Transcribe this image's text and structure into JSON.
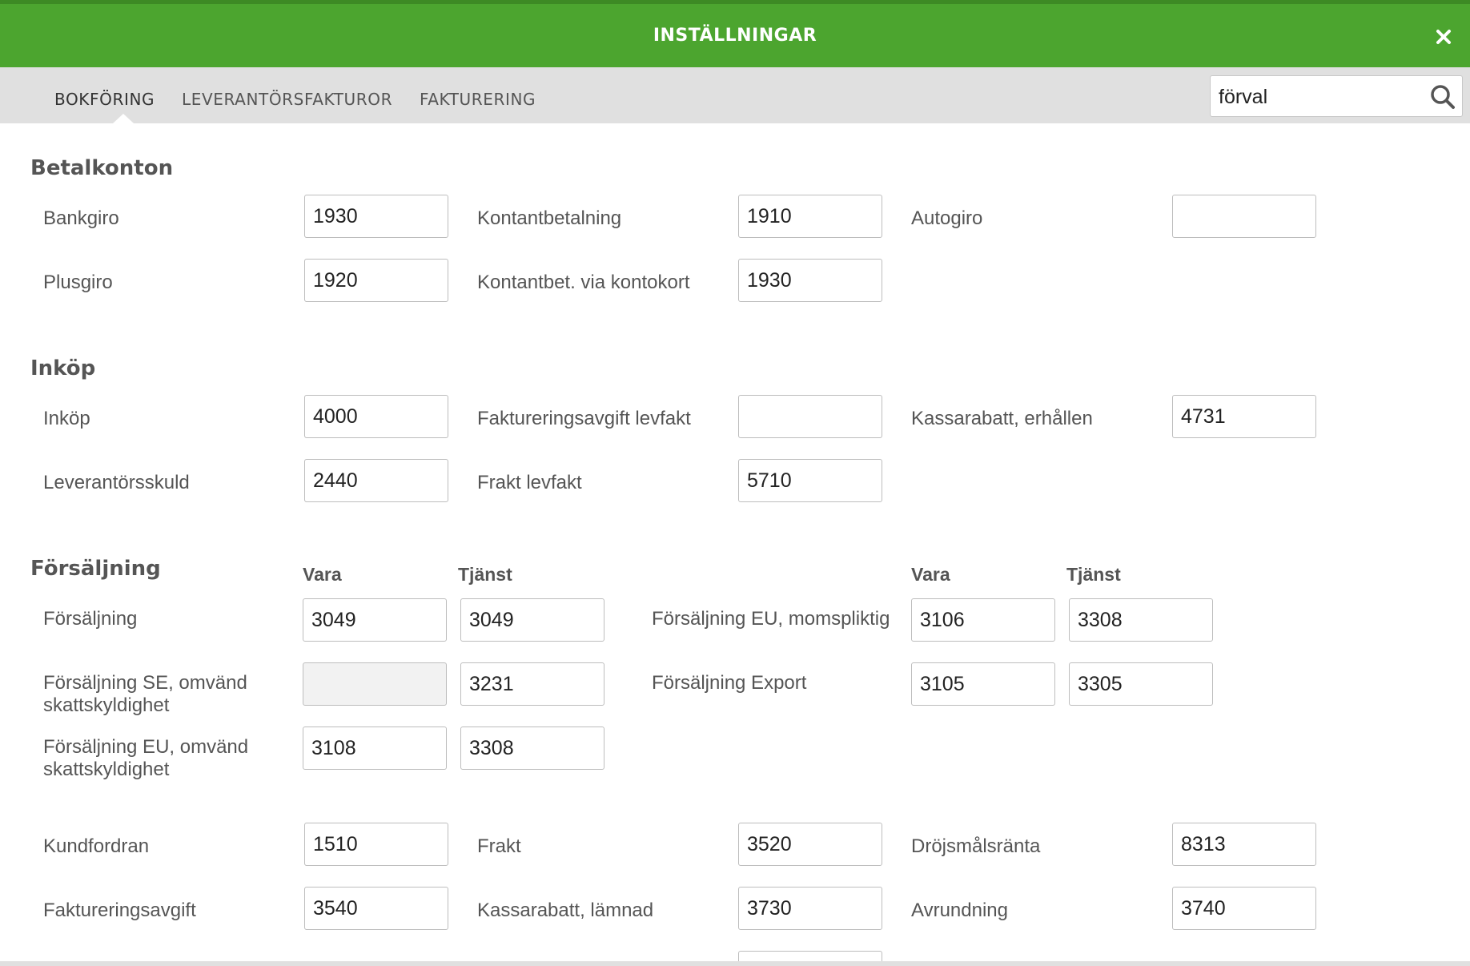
{
  "header": {
    "title": "INSTÄLLNINGAR"
  },
  "tabs": [
    {
      "label": "BOKFÖRING"
    },
    {
      "label": "LEVERANTÖRSFAKTUROR"
    },
    {
      "label": "FAKTURERING"
    }
  ],
  "search": {
    "value": "förval"
  },
  "betalkonton": {
    "title": "Betalkonton",
    "bankgiro": {
      "label": "Bankgiro",
      "value": "1930"
    },
    "kontantbetalning": {
      "label": "Kontantbetalning",
      "value": "1910"
    },
    "autogiro": {
      "label": "Autogiro",
      "value": ""
    },
    "plusgiro": {
      "label": "Plusgiro",
      "value": "1920"
    },
    "kontantbet_kontokort": {
      "label": "Kontantbet. via kontokort",
      "value": "1930"
    }
  },
  "inkop": {
    "title": "Inköp",
    "inkop": {
      "label": "Inköp",
      "value": "4000"
    },
    "faktureringsavgift_levfakt": {
      "label": "Faktureringsavgift levfakt",
      "value": ""
    },
    "kassarabatt_erhallen": {
      "label": "Kassarabatt, erhållen",
      "value": "4731"
    },
    "leverantorsskuld": {
      "label": "Leverantörsskuld",
      "value": "2440"
    },
    "frakt_levfakt": {
      "label": "Frakt levfakt",
      "value": "5710"
    }
  },
  "forsaljning": {
    "title": "Försäljning",
    "col_vara": "Vara",
    "col_tjanst": "Tjänst",
    "forsaljning": {
      "label": "Försäljning",
      "vara": "3049",
      "tjanst": "3049"
    },
    "eu_momspliktig": {
      "label": "Försäljning EU, momspliktig",
      "vara": "3106",
      "tjanst": "3308"
    },
    "se_omvand_line1": "Försäljning SE, omvänd",
    "se_omvand_line2": "skattskyldighet",
    "se_omvand": {
      "vara": "",
      "tjanst": "3231"
    },
    "export": {
      "label": "Försäljning Export",
      "vara": "3105",
      "tjanst": "3305"
    },
    "eu_omvand_line1": "Försäljning EU, omvänd",
    "eu_omvand_line2": "skattskyldighet",
    "eu_omvand": {
      "vara": "3108",
      "tjanst": "3308"
    }
  },
  "ovrigt": {
    "kundfordran": {
      "label": "Kundfordran",
      "value": "1510"
    },
    "frakt": {
      "label": "Frakt",
      "value": "3520"
    },
    "drojsmalsranta": {
      "label": "Dröjsmålsränta",
      "value": "8313"
    },
    "faktureringsavgift": {
      "label": "Faktureringsavgift",
      "value": "3540"
    },
    "kassarabatt_lamnad": {
      "label": "Kassarabatt, lämnad",
      "value": "3730"
    },
    "avrundning": {
      "label": "Avrundning",
      "value": "3740"
    }
  }
}
